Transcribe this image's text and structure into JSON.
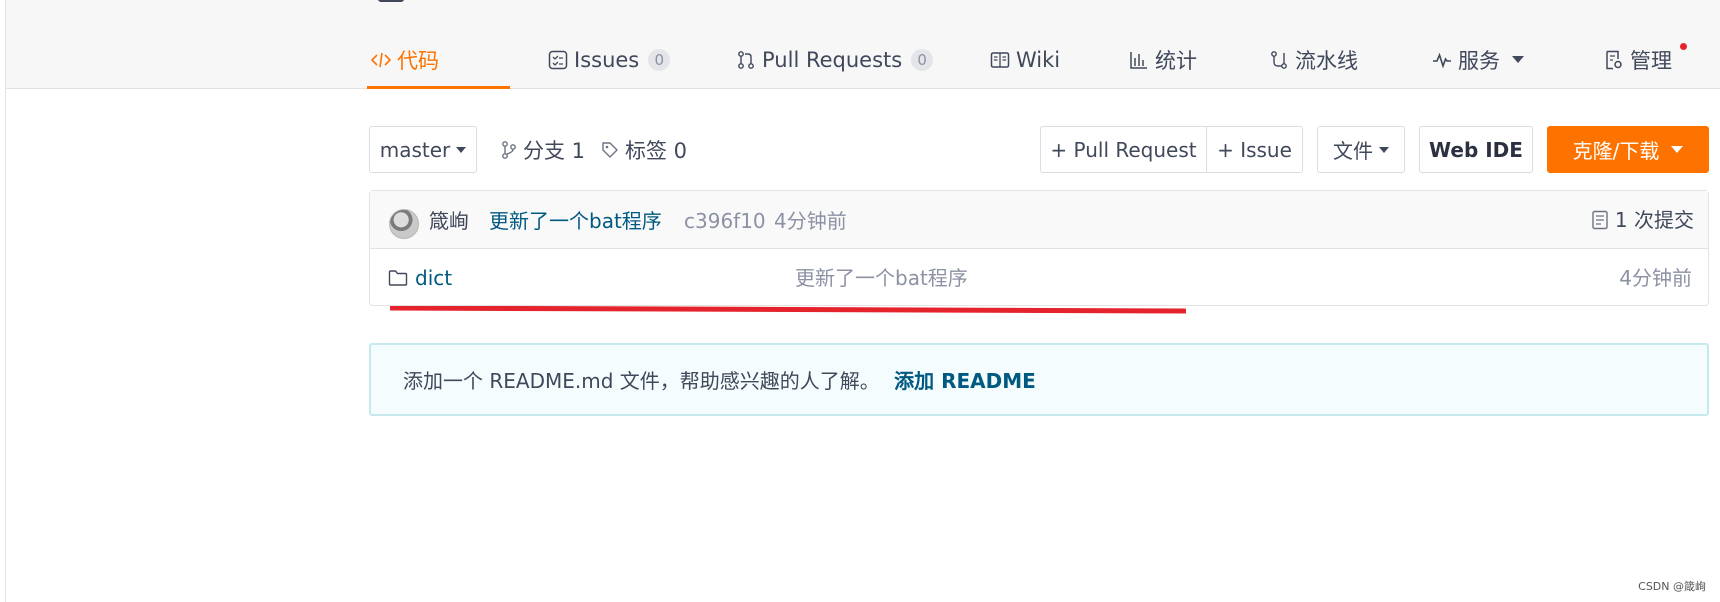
{
  "nav": {
    "tabs": [
      {
        "label": "代码",
        "icon": "code-icon",
        "active": true
      },
      {
        "label": "Issues",
        "icon": "issues-icon",
        "count": "0"
      },
      {
        "label": "Pull Requests",
        "icon": "pull-request-icon",
        "count": "0"
      },
      {
        "label": "Wiki",
        "icon": "book-icon"
      },
      {
        "label": "统计",
        "icon": "bar-chart-icon"
      },
      {
        "label": "流水线",
        "icon": "pipeline-icon"
      },
      {
        "label": "服务",
        "icon": "pulse-icon"
      },
      {
        "label": "管理",
        "icon": "settings-doc-icon"
      }
    ],
    "active_color": "#fe7300"
  },
  "toolbar": {
    "branch": "master",
    "branches_label": "分支 1",
    "tags_label": "标签 0",
    "pull_request_label": "+ Pull Request",
    "issue_label": "+ Issue",
    "file_label": "文件",
    "web_ide_label": "Web IDE",
    "clone_label": "克隆/下载",
    "clone_color": "#fe7300"
  },
  "commit": {
    "author": "箴峋",
    "message": "更新了一个bat程序",
    "hash": "c396f10",
    "time": "4分钟前",
    "commits_count": "1 次提交"
  },
  "files": [
    {
      "name": "dict",
      "icon": "folder-icon",
      "message": "更新了一个bat程序",
      "time": "4分钟前"
    }
  ],
  "readme_banner": {
    "text": "添加一个 README.md 文件，帮助感兴趣的人了解。",
    "action": "添加 README"
  },
  "watermark": "CSDN @箴峋"
}
